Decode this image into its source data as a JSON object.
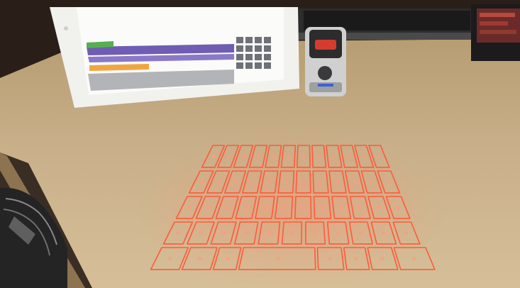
{
  "scene": {
    "title": "",
    "colors": {
      "desk_light": "#cdb48d",
      "desk_mid": "#b39668",
      "desk_dark": "#6d5738",
      "wall": "#231a14",
      "tablet_frame": "#eeeeeb",
      "tablet_screen": "#f8f8f6",
      "laser_red": "#ff5a3a",
      "laser_glow": "#ff9a7a",
      "border": "#1b1b1b"
    },
    "objects": [
      "tablet",
      "projector-device",
      "laptop",
      "screen-right",
      "desk",
      "laser-keyboard-projection",
      "chair"
    ]
  },
  "keyboard_layout": {
    "rows": [
      {
        "keys": 12
      },
      {
        "keys": 12
      },
      {
        "keys": 12
      },
      {
        "keys": 11
      },
      {
        "keys": 8
      }
    ]
  }
}
